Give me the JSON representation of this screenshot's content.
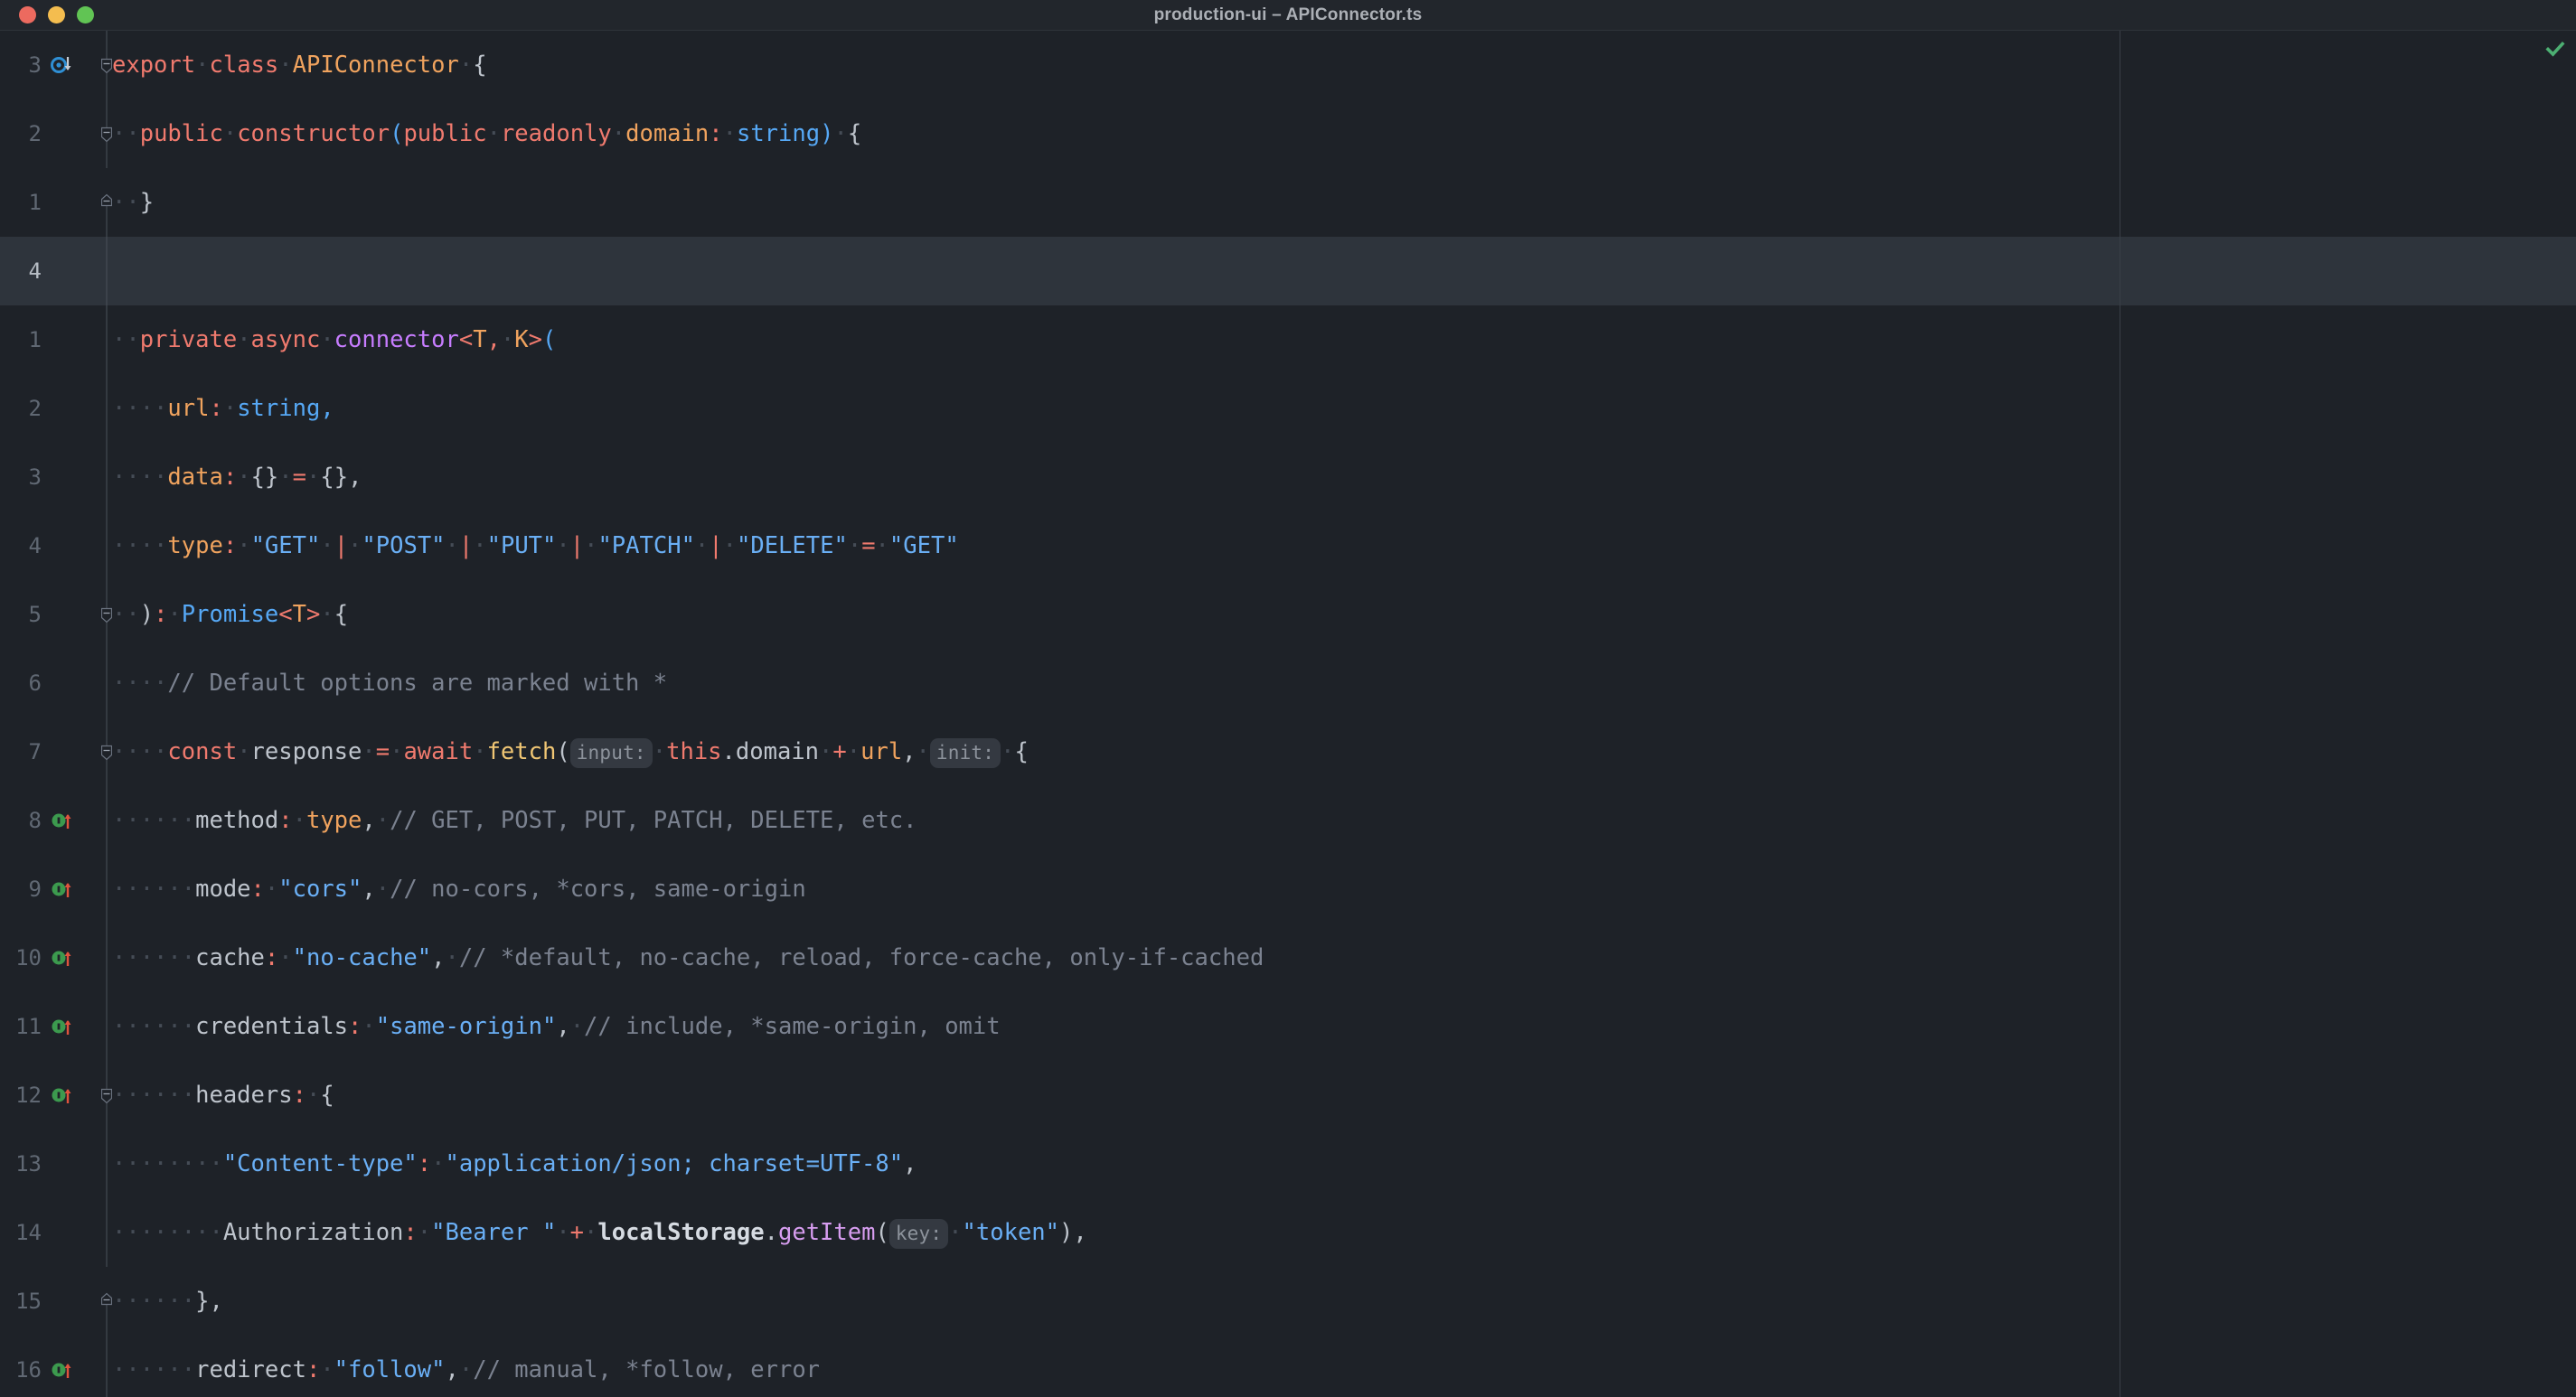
{
  "window": {
    "title": "production-ui – APIConnector.ts",
    "traffic_lights": [
      {
        "name": "close",
        "color": "#ec6a5f"
      },
      {
        "name": "minimize",
        "color": "#f4bd4f"
      },
      {
        "name": "maximize",
        "color": "#61c454"
      }
    ]
  },
  "editor": {
    "filename": "APIConnector.ts",
    "language": "TypeScript",
    "theme": "dark",
    "inspection_status": "ok",
    "inspection_icon": "green-check-icon",
    "current_line_number": "4",
    "lines": [
      {
        "num": "3",
        "current": false,
        "gutter_icon": "breakpoint-override-icon",
        "fold": "minus",
        "tokens": [
          {
            "t": "export",
            "c": "kw"
          },
          {
            "t": " ",
            "c": "ws"
          },
          {
            "t": "class",
            "c": "kw"
          },
          {
            "t": " ",
            "c": "ws"
          },
          {
            "t": "APIConnector",
            "c": "type"
          },
          {
            "t": " ",
            "c": "ws"
          },
          {
            "t": "{",
            "c": "punct"
          }
        ]
      },
      {
        "num": "2",
        "current": false,
        "gutter_icon": "",
        "fold": "minus",
        "tokens": [
          {
            "t": "  ",
            "c": "ws"
          },
          {
            "t": "public",
            "c": "kw"
          },
          {
            "t": " ",
            "c": "ws"
          },
          {
            "t": "constructor",
            "c": "kw"
          },
          {
            "t": "(",
            "c": "bltin"
          },
          {
            "t": "public",
            "c": "kw"
          },
          {
            "t": " ",
            "c": "ws"
          },
          {
            "t": "readonly",
            "c": "kw"
          },
          {
            "t": " ",
            "c": "ws"
          },
          {
            "t": "domain",
            "c": "type"
          },
          {
            "t": ":",
            "c": "colon"
          },
          {
            "t": " ",
            "c": "ws"
          },
          {
            "t": "string",
            "c": "bltin"
          },
          {
            "t": ")",
            "c": "bltin"
          },
          {
            "t": " ",
            "c": "ws"
          },
          {
            "t": "{",
            "c": "punct"
          }
        ]
      },
      {
        "num": "1",
        "current": false,
        "gutter_icon": "",
        "fold": "end",
        "tokens": [
          {
            "t": "  ",
            "c": "ws"
          },
          {
            "t": "}",
            "c": "punct"
          }
        ]
      },
      {
        "num": "4",
        "current": true,
        "gutter_icon": "",
        "fold": "",
        "tokens": []
      },
      {
        "num": "1",
        "current": false,
        "gutter_icon": "",
        "fold": "",
        "tokens": [
          {
            "t": "  ",
            "c": "ws"
          },
          {
            "t": "private",
            "c": "kw"
          },
          {
            "t": " ",
            "c": "ws"
          },
          {
            "t": "async",
            "c": "kw"
          },
          {
            "t": " ",
            "c": "ws"
          },
          {
            "t": "connector",
            "c": "kw2"
          },
          {
            "t": "<",
            "c": "op"
          },
          {
            "t": "T",
            "c": "type"
          },
          {
            "t": ",",
            "c": "op"
          },
          {
            "t": " ",
            "c": "ws"
          },
          {
            "t": "K",
            "c": "type"
          },
          {
            "t": ">",
            "c": "op"
          },
          {
            "t": "(",
            "c": "bltin"
          }
        ]
      },
      {
        "num": "2",
        "current": false,
        "gutter_icon": "",
        "fold": "",
        "tokens": [
          {
            "t": "    ",
            "c": "ws"
          },
          {
            "t": "url",
            "c": "type"
          },
          {
            "t": ":",
            "c": "colon"
          },
          {
            "t": " ",
            "c": "ws"
          },
          {
            "t": "string",
            "c": "bltin"
          },
          {
            "t": ",",
            "c": "bltin"
          }
        ]
      },
      {
        "num": "3",
        "current": false,
        "gutter_icon": "",
        "fold": "",
        "tokens": [
          {
            "t": "    ",
            "c": "ws"
          },
          {
            "t": "data",
            "c": "type"
          },
          {
            "t": ":",
            "c": "colon"
          },
          {
            "t": " ",
            "c": "ws"
          },
          {
            "t": "{}",
            "c": "punct"
          },
          {
            "t": " ",
            "c": "ws"
          },
          {
            "t": "=",
            "c": "op"
          },
          {
            "t": " ",
            "c": "ws"
          },
          {
            "t": "{}",
            "c": "punct"
          },
          {
            "t": ",",
            "c": "punct"
          }
        ]
      },
      {
        "num": "4",
        "current": false,
        "gutter_icon": "",
        "fold": "",
        "tokens": [
          {
            "t": "    ",
            "c": "ws"
          },
          {
            "t": "type",
            "c": "type"
          },
          {
            "t": ":",
            "c": "colon"
          },
          {
            "t": " ",
            "c": "ws"
          },
          {
            "t": "\"GET\"",
            "c": "str"
          },
          {
            "t": " ",
            "c": "ws"
          },
          {
            "t": "|",
            "c": "op"
          },
          {
            "t": " ",
            "c": "ws"
          },
          {
            "t": "\"POST\"",
            "c": "str"
          },
          {
            "t": " ",
            "c": "ws"
          },
          {
            "t": "|",
            "c": "op"
          },
          {
            "t": " ",
            "c": "ws"
          },
          {
            "t": "\"PUT\"",
            "c": "str"
          },
          {
            "t": " ",
            "c": "ws"
          },
          {
            "t": "|",
            "c": "op"
          },
          {
            "t": " ",
            "c": "ws"
          },
          {
            "t": "\"PATCH\"",
            "c": "str"
          },
          {
            "t": " ",
            "c": "ws"
          },
          {
            "t": "|",
            "c": "op"
          },
          {
            "t": " ",
            "c": "ws"
          },
          {
            "t": "\"DELETE\"",
            "c": "str"
          },
          {
            "t": " ",
            "c": "ws"
          },
          {
            "t": "=",
            "c": "op"
          },
          {
            "t": " ",
            "c": "ws"
          },
          {
            "t": "\"GET\"",
            "c": "str"
          }
        ]
      },
      {
        "num": "5",
        "current": false,
        "gutter_icon": "",
        "fold": "minus",
        "tokens": [
          {
            "t": "  ",
            "c": "ws"
          },
          {
            "t": ")",
            "c": "punct"
          },
          {
            "t": ":",
            "c": "colon"
          },
          {
            "t": " ",
            "c": "ws"
          },
          {
            "t": "Promise",
            "c": "bltin"
          },
          {
            "t": "<",
            "c": "op"
          },
          {
            "t": "T",
            "c": "type"
          },
          {
            "t": ">",
            "c": "op"
          },
          {
            "t": " ",
            "c": "ws"
          },
          {
            "t": "{",
            "c": "punct"
          }
        ]
      },
      {
        "num": "6",
        "current": false,
        "gutter_icon": "",
        "fold": "",
        "tokens": [
          {
            "t": "    ",
            "c": "ws"
          },
          {
            "t": "// Default options are marked with *",
            "c": "cmt"
          }
        ]
      },
      {
        "num": "7",
        "current": false,
        "gutter_icon": "",
        "fold": "minus",
        "tokens": [
          {
            "t": "    ",
            "c": "ws"
          },
          {
            "t": "const",
            "c": "kw"
          },
          {
            "t": " ",
            "c": "ws"
          },
          {
            "t": "response",
            "c": "prop"
          },
          {
            "t": " ",
            "c": "ws"
          },
          {
            "t": "=",
            "c": "op"
          },
          {
            "t": " ",
            "c": "ws"
          },
          {
            "t": "await",
            "c": "kw"
          },
          {
            "t": " ",
            "c": "ws"
          },
          {
            "t": "fetch",
            "c": "fn"
          },
          {
            "t": "(",
            "c": "punct"
          },
          {
            "t": "input:",
            "c": "hint"
          },
          {
            "t": " ",
            "c": "ws"
          },
          {
            "t": "this",
            "c": "kw"
          },
          {
            "t": ".",
            "c": "dotop"
          },
          {
            "t": "domain",
            "c": "prop"
          },
          {
            "t": " ",
            "c": "ws"
          },
          {
            "t": "+",
            "c": "op"
          },
          {
            "t": " ",
            "c": "ws"
          },
          {
            "t": "url",
            "c": "type"
          },
          {
            "t": ",",
            "c": "punct"
          },
          {
            "t": " ",
            "c": "ws"
          },
          {
            "t": "init:",
            "c": "hint"
          },
          {
            "t": " ",
            "c": "ws"
          },
          {
            "t": "{",
            "c": "punct"
          }
        ]
      },
      {
        "num": "8",
        "current": false,
        "gutter_icon": "vcs-change-icon",
        "fold": "",
        "tokens": [
          {
            "t": "      ",
            "c": "ws"
          },
          {
            "t": "method",
            "c": "prop"
          },
          {
            "t": ":",
            "c": "colon"
          },
          {
            "t": " ",
            "c": "ws"
          },
          {
            "t": "type",
            "c": "type"
          },
          {
            "t": ",",
            "c": "punct"
          },
          {
            "t": " ",
            "c": "ws"
          },
          {
            "t": "// GET, POST, PUT, PATCH, DELETE, etc.",
            "c": "cmt"
          }
        ]
      },
      {
        "num": "9",
        "current": false,
        "gutter_icon": "vcs-change-icon",
        "fold": "",
        "tokens": [
          {
            "t": "      ",
            "c": "ws"
          },
          {
            "t": "mode",
            "c": "prop"
          },
          {
            "t": ":",
            "c": "colon"
          },
          {
            "t": " ",
            "c": "ws"
          },
          {
            "t": "\"cors\"",
            "c": "str"
          },
          {
            "t": ",",
            "c": "punct"
          },
          {
            "t": " ",
            "c": "ws"
          },
          {
            "t": "// no-cors, *cors, same-origin",
            "c": "cmt"
          }
        ]
      },
      {
        "num": "10",
        "current": false,
        "gutter_icon": "vcs-change-icon",
        "fold": "",
        "tokens": [
          {
            "t": "      ",
            "c": "ws"
          },
          {
            "t": "cache",
            "c": "prop"
          },
          {
            "t": ":",
            "c": "colon"
          },
          {
            "t": " ",
            "c": "ws"
          },
          {
            "t": "\"no-cache\"",
            "c": "str"
          },
          {
            "t": ",",
            "c": "punct"
          },
          {
            "t": " ",
            "c": "ws"
          },
          {
            "t": "// *default, no-cache, reload, force-cache, only-if-cached",
            "c": "cmt"
          }
        ]
      },
      {
        "num": "11",
        "current": false,
        "gutter_icon": "vcs-change-icon",
        "fold": "",
        "tokens": [
          {
            "t": "      ",
            "c": "ws"
          },
          {
            "t": "credentials",
            "c": "prop"
          },
          {
            "t": ":",
            "c": "colon"
          },
          {
            "t": " ",
            "c": "ws"
          },
          {
            "t": "\"same-origin\"",
            "c": "str"
          },
          {
            "t": ",",
            "c": "punct"
          },
          {
            "t": " ",
            "c": "ws"
          },
          {
            "t": "// include, *same-origin, omit",
            "c": "cmt"
          }
        ]
      },
      {
        "num": "12",
        "current": false,
        "gutter_icon": "vcs-change-icon",
        "fold": "minus",
        "tokens": [
          {
            "t": "      ",
            "c": "ws"
          },
          {
            "t": "headers",
            "c": "prop"
          },
          {
            "t": ":",
            "c": "colon"
          },
          {
            "t": " ",
            "c": "ws"
          },
          {
            "t": "{",
            "c": "punct"
          }
        ]
      },
      {
        "num": "13",
        "current": false,
        "gutter_icon": "",
        "fold": "",
        "tokens": [
          {
            "t": "        ",
            "c": "ws"
          },
          {
            "t": "\"Content-type\"",
            "c": "str"
          },
          {
            "t": ":",
            "c": "colon"
          },
          {
            "t": " ",
            "c": "ws"
          },
          {
            "t": "\"application/json; charset=UTF-8\"",
            "c": "str"
          },
          {
            "t": ",",
            "c": "punct"
          }
        ]
      },
      {
        "num": "14",
        "current": false,
        "gutter_icon": "",
        "fold": "",
        "tokens": [
          {
            "t": "        ",
            "c": "ws"
          },
          {
            "t": "Authorization",
            "c": "prop"
          },
          {
            "t": ":",
            "c": "colon"
          },
          {
            "t": " ",
            "c": "ws"
          },
          {
            "t": "\"Bearer \"",
            "c": "str"
          },
          {
            "t": " ",
            "c": "ws"
          },
          {
            "t": "+",
            "c": "op"
          },
          {
            "t": " ",
            "c": "ws"
          },
          {
            "t": "localStorage",
            "c": "bold"
          },
          {
            "t": ".",
            "c": "dotop"
          },
          {
            "t": "getItem",
            "c": "pinkfn"
          },
          {
            "t": "(",
            "c": "punct"
          },
          {
            "t": "key:",
            "c": "hint"
          },
          {
            "t": " ",
            "c": "ws"
          },
          {
            "t": "\"token\"",
            "c": "str"
          },
          {
            "t": ")",
            "c": "punct"
          },
          {
            "t": ",",
            "c": "punct"
          }
        ]
      },
      {
        "num": "15",
        "current": false,
        "gutter_icon": "",
        "fold": "end",
        "tokens": [
          {
            "t": "      ",
            "c": "ws"
          },
          {
            "t": "}",
            "c": "punct"
          },
          {
            "t": ",",
            "c": "punct"
          }
        ]
      },
      {
        "num": "16",
        "current": false,
        "gutter_icon": "vcs-change-icon",
        "fold": "",
        "tokens": [
          {
            "t": "      ",
            "c": "ws"
          },
          {
            "t": "redirect",
            "c": "prop"
          },
          {
            "t": ":",
            "c": "colon"
          },
          {
            "t": " ",
            "c": "ws"
          },
          {
            "t": "\"follow\"",
            "c": "str"
          },
          {
            "t": ",",
            "c": "punct"
          },
          {
            "t": " ",
            "c": "ws"
          },
          {
            "t": "// manual, *follow, error",
            "c": "cmt"
          }
        ]
      }
    ]
  }
}
